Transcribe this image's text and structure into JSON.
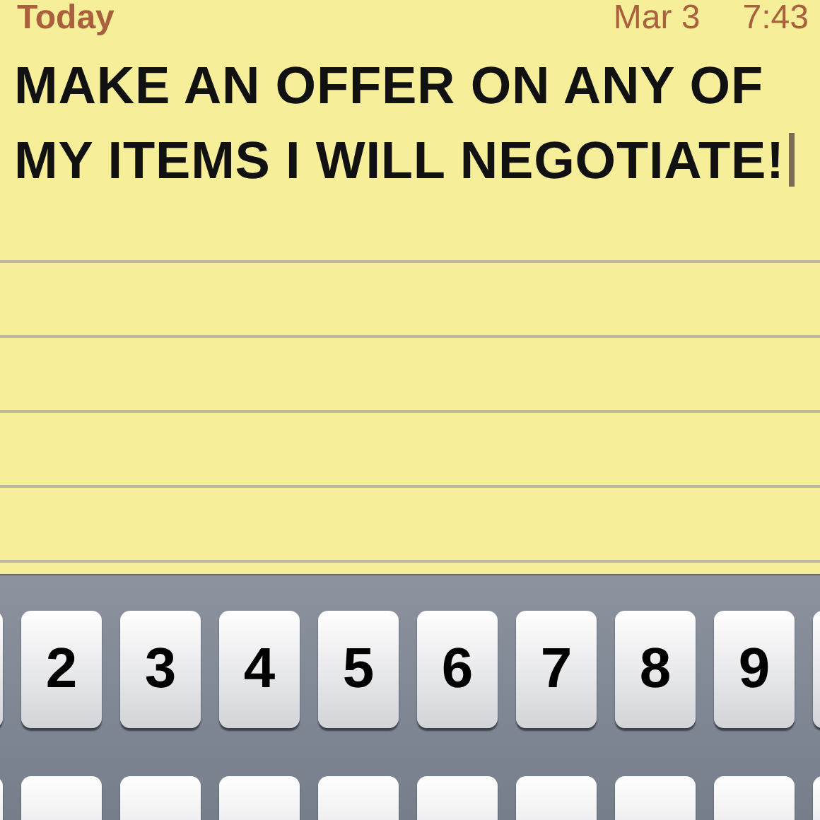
{
  "header": {
    "title": "Today",
    "date": "Mar 3",
    "time": "7:43"
  },
  "note": {
    "text": "MAKE AN OFFER ON ANY OF MY ITEMS I WILL NEGOTIATE!"
  },
  "keyboard": {
    "rows": [
      [
        "",
        "2",
        "3",
        "4",
        "5",
        "6",
        "7",
        "8",
        "9",
        ""
      ],
      [
        "",
        "",
        "",
        "",
        "",
        "",
        "",
        "",
        "",
        ""
      ]
    ]
  }
}
